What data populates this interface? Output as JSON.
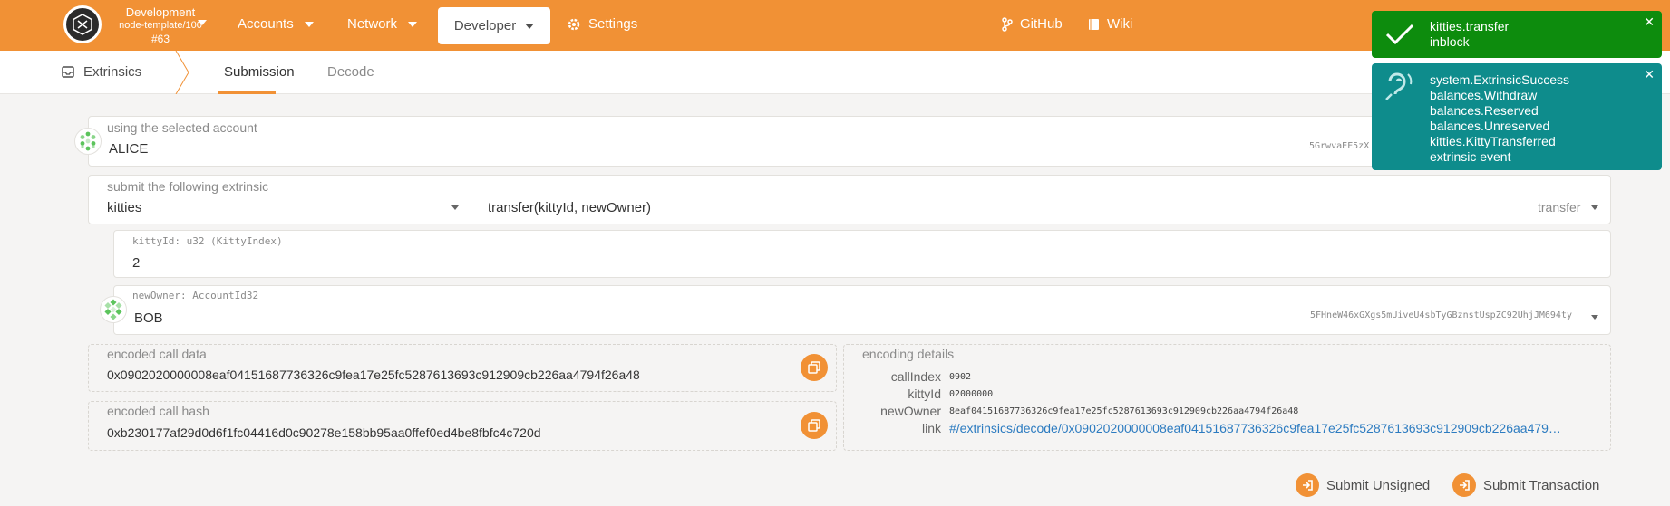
{
  "chain": {
    "name": "Development",
    "runtime": "node-template/100",
    "block": "#63"
  },
  "nav": {
    "accounts": "Accounts",
    "network": "Network",
    "developer": "Developer",
    "settings": "Settings",
    "github": "GitHub",
    "wiki": "Wiki"
  },
  "subnav": {
    "extrinsics": "Extrinsics",
    "submission": "Submission",
    "decode": "Decode"
  },
  "account": {
    "label": "using the selected account",
    "name": "ALICE",
    "address": "5GrwvaEF5zX"
  },
  "extrinsic": {
    "label": "submit the following extrinsic",
    "module": "kitties",
    "call_signature": "transfer(kittyId, newOwner)",
    "method": "transfer"
  },
  "params": {
    "kittyId": {
      "label": "kittyId: u32 (KittyIndex)",
      "value": "2"
    },
    "newOwner": {
      "label": "newOwner: AccountId32",
      "name": "BOB",
      "address": "5FHneW46xGXgs5mUiveU4sbTyGBznstUspZC92UhjJM694ty"
    }
  },
  "encoded": {
    "call_data_label": "encoded call data",
    "call_data": "0x0902020000008eaf04151687736326c9fea17e25fc5287613693c912909cb226aa4794f26a48",
    "call_hash_label": "encoded call hash",
    "call_hash": "0xb230177af29d0d6f1fc04416d0c90278e158bb95aa0ffef0ed4be8fbfc4c720d"
  },
  "encoding_details": {
    "label": "encoding details",
    "rows": [
      {
        "key": "callIndex",
        "value": "0902"
      },
      {
        "key": "kittyId",
        "value": "02000000"
      },
      {
        "key": "newOwner",
        "value": "8eaf04151687736326c9fea17e25fc5287613693c912909cb226aa4794f26a48"
      },
      {
        "key": "link",
        "value": "#/extrinsics/decode/0x0902020000008eaf04151687736326c9fea17e25fc5287613693c912909cb226aa479…"
      }
    ]
  },
  "actions": {
    "submit_unsigned": "Submit Unsigned",
    "submit_transaction": "Submit Transaction"
  },
  "toasts": {
    "first": {
      "title": "kitties.transfer",
      "status": "inblock"
    },
    "second": {
      "lines": [
        "system.ExtrinsicSuccess",
        "balances.Withdraw",
        "balances.Reserved",
        "balances.Unreserved",
        "kitties.KittyTransferred"
      ],
      "status": "extrinsic event"
    }
  },
  "colors": {
    "brand": "#f19135",
    "toast_success": "#0d8c0d",
    "toast_event": "#0e8c8c",
    "link": "#2c7bc0"
  }
}
